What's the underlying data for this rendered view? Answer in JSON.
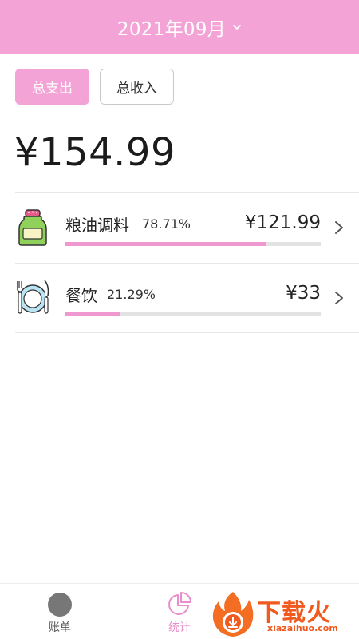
{
  "header": {
    "title": "2021年09月"
  },
  "tabs": {
    "expense": "总支出",
    "income": "总收入"
  },
  "total": "¥154.99",
  "categories": [
    {
      "name": "粮油调料",
      "percent": "78.71%",
      "amount": "¥121.99",
      "fraction": 0.7871,
      "icon": "condiment-jar-icon"
    },
    {
      "name": "餐饮",
      "percent": "21.29%",
      "amount": "¥33",
      "fraction": 0.2129,
      "icon": "plate-fork-knife-icon"
    }
  ],
  "nav": {
    "bills": "账单",
    "stats": "统计"
  },
  "watermark": {
    "text": "下载火",
    "url": "xiazaihuo.com"
  },
  "colors": {
    "accent": "#f4a3d6",
    "bar": "#ef97cf",
    "watermark": "#f05a1e"
  }
}
